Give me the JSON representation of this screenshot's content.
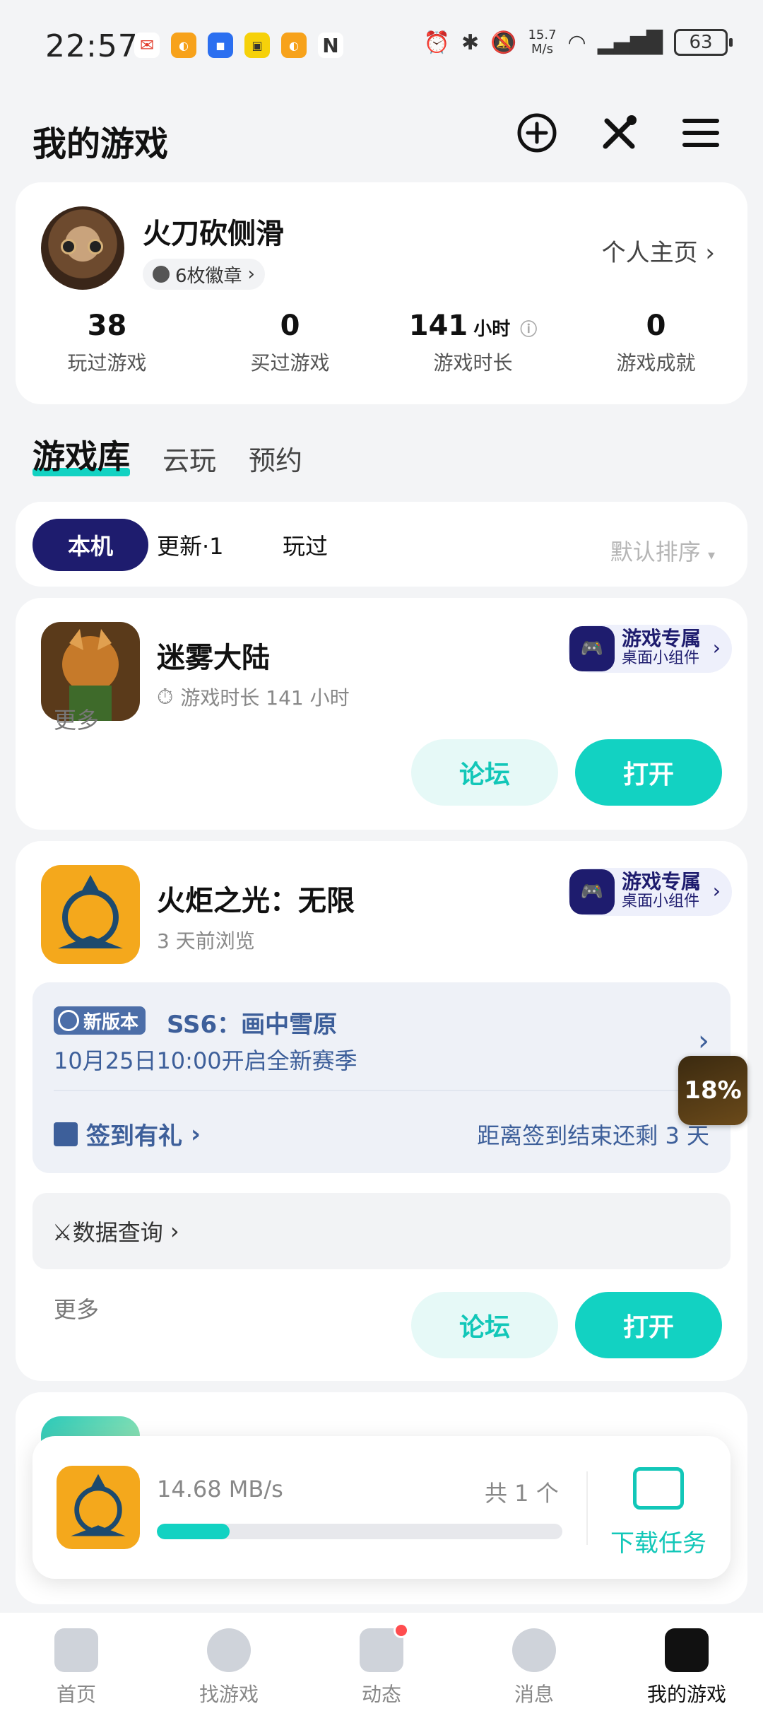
{
  "status_bar": {
    "time": "22:57",
    "net_speed_value": "15.7",
    "net_speed_unit": "M/s",
    "battery": "63"
  },
  "header": {
    "title": "我的游戏"
  },
  "profile": {
    "username": "火刀砍侧滑",
    "badge_label": "6枚徽章",
    "homepage_label": "个人主页",
    "stats": [
      {
        "num": "38",
        "unit": "",
        "label": "玩过游戏"
      },
      {
        "num": "0",
        "unit": "",
        "label": "买过游戏"
      },
      {
        "num": "141",
        "unit": "小时",
        "label": "游戏时长"
      },
      {
        "num": "0",
        "unit": "",
        "label": "游戏成就"
      }
    ]
  },
  "library_tabs": [
    "游戏库",
    "云玩",
    "预约"
  ],
  "filter": {
    "chips": [
      "本机",
      "更新·1",
      "玩过"
    ],
    "sort": "默认排序"
  },
  "widget": {
    "line1": "游戏专属",
    "line2": "桌面小组件"
  },
  "buttons": {
    "more": "更多",
    "forum": "论坛",
    "open": "打开"
  },
  "games": [
    {
      "name": "迷雾大陆",
      "sub": "游戏时长 141 小时"
    },
    {
      "name": "火炬之光：无限",
      "sub": "3 天前浏览",
      "news": {
        "tag": "新版本",
        "title": "SS6：画中雪原",
        "date": "10月25日10:00开启全新赛季",
        "sign_label": "签到有礼",
        "sign_remain": "距离签到结束还剩 3 天"
      },
      "data_query": "⚔数据查询"
    }
  ],
  "floating_progress": "18%",
  "download": {
    "speed": "14.68 MB/s",
    "count": "共 1 个",
    "progress": 0.18,
    "task_label": "下载任务"
  },
  "bottom_nav": [
    "首页",
    "找游戏",
    "动态",
    "消息",
    "我的游戏"
  ],
  "colors": {
    "accent": "#12d2c2",
    "brand_dark": "#1e1c6e",
    "news_blue": "#3d5f9a"
  }
}
